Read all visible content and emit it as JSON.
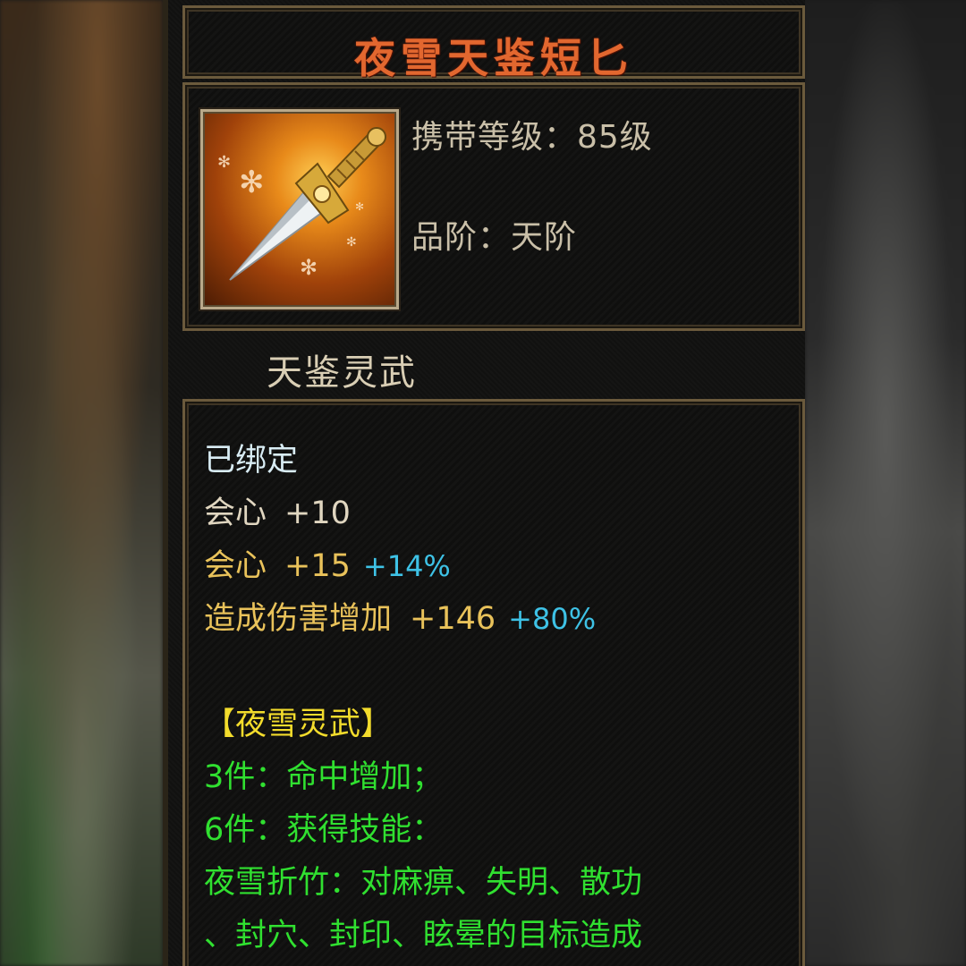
{
  "item": {
    "name": "夜雪天鉴短匕",
    "level_text": "携带等级：85级",
    "grade_text": "品阶：天阶",
    "series": "天鉴灵武",
    "icon": "dagger-icon"
  },
  "attributes": {
    "bound": "已绑定",
    "stats": [
      {
        "name": "会心",
        "value": "+10",
        "bonus": ""
      },
      {
        "name": "会心",
        "value": "+15",
        "bonus": "+14%"
      },
      {
        "name": "造成伤害增加",
        "value": "+146",
        "bonus": "+80%"
      }
    ]
  },
  "set": {
    "title": "【夜雪灵武】",
    "lines": [
      "3件：命中增加；",
      "6件：获得技能：",
      "夜雪折竹：对麻痹、失明、散功",
      "、封穴、封印、眩晕的目标造成"
    ]
  },
  "colors": {
    "title": "#e2672f",
    "bonus": "#3ec2e6",
    "set_text": "#30e030",
    "set_title": "#f3dc2c"
  }
}
